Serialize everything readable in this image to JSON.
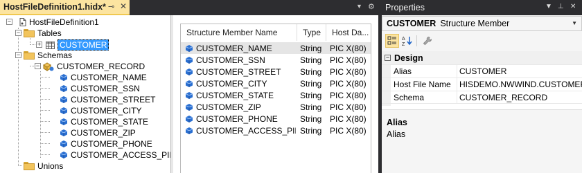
{
  "document": {
    "tab_title": "HostFileDefinition1.hidx*",
    "pin_glyph": "⊸",
    "close_glyph": "✕",
    "dropdown_glyph": "▼",
    "settings_glyph": "⚙"
  },
  "tree": {
    "root": "HostFileDefinition1",
    "tables": "Tables",
    "customer": "CUSTOMER",
    "schemas": "Schemas",
    "record": "CUSTOMER_RECORD",
    "members": [
      "CUSTOMER_NAME",
      "CUSTOMER_SSN",
      "CUSTOMER_STREET",
      "CUSTOMER_CITY",
      "CUSTOMER_STATE",
      "CUSTOMER_ZIP",
      "CUSTOMER_PHONE",
      "CUSTOMER_ACCESS_PIN"
    ],
    "unions": "Unions"
  },
  "list": {
    "columns": [
      "Structure Member Name",
      "Type",
      "Host Da..."
    ],
    "rows": [
      {
        "name": "CUSTOMER_NAME",
        "type": "String",
        "host": "PIC X(80)"
      },
      {
        "name": "CUSTOMER_SSN",
        "type": "String",
        "host": "PIC X(80)"
      },
      {
        "name": "CUSTOMER_STREET",
        "type": "String",
        "host": "PIC X(80)"
      },
      {
        "name": "CUSTOMER_CITY",
        "type": "String",
        "host": "PIC X(80)"
      },
      {
        "name": "CUSTOMER_STATE",
        "type": "String",
        "host": "PIC X(80)"
      },
      {
        "name": "CUSTOMER_ZIP",
        "type": "String",
        "host": "PIC X(80)"
      },
      {
        "name": "CUSTOMER_PHONE",
        "type": "String",
        "host": "PIC X(80)"
      },
      {
        "name": "CUSTOMER_ACCESS_PIN",
        "type": "String",
        "host": "PIC X(80)"
      }
    ]
  },
  "properties": {
    "title": "Properties",
    "object_name": "CUSTOMER",
    "object_type": "Structure Member",
    "category": "Design",
    "rows": [
      {
        "name": "Alias",
        "value": "CUSTOMER"
      },
      {
        "name": "Host File Name",
        "value": "HISDEMO.NWWIND.CUSTOMER.DAT"
      },
      {
        "name": "Schema",
        "value": "CUSTOMER_RECORD"
      }
    ],
    "desc_title": "Alias",
    "desc_text": "Alias"
  },
  "colors": {
    "active_tab": "#fce4a0",
    "chrome_dark": "#2d2d30",
    "selection": "#3399ff",
    "member_icon": "#2a6fd1"
  }
}
